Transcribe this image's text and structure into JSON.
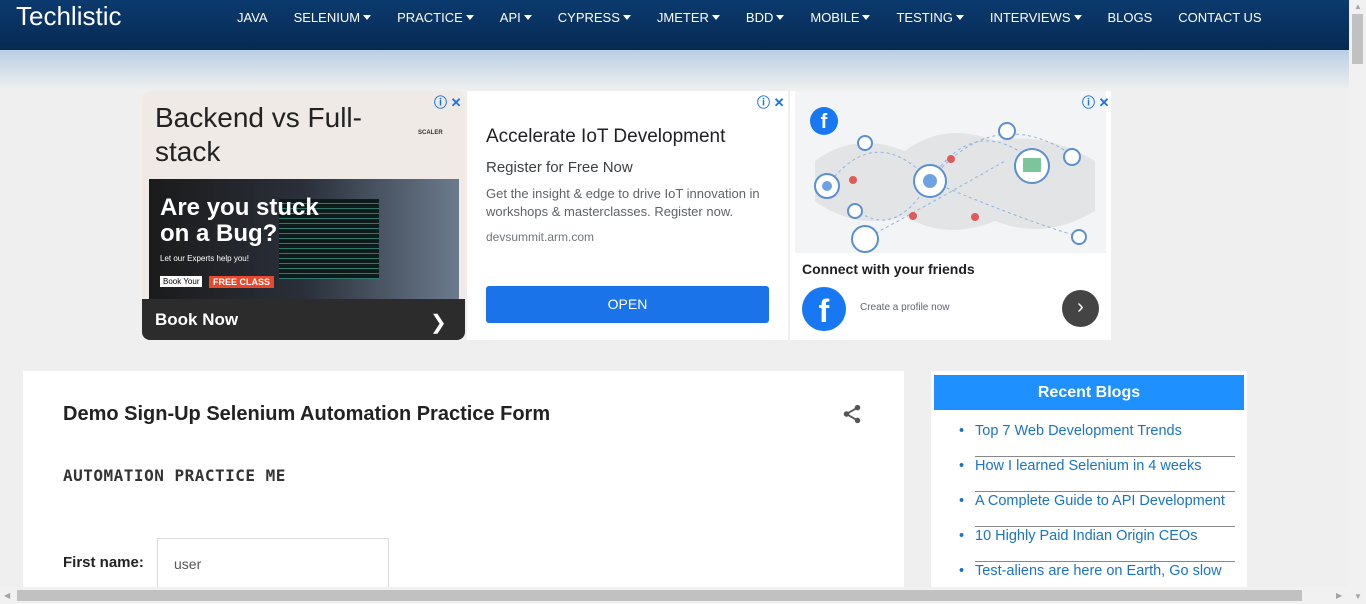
{
  "header": {
    "brand": "Techlistic",
    "nav": [
      {
        "label": "JAVA",
        "dropdown": false
      },
      {
        "label": "SELENIUM",
        "dropdown": true
      },
      {
        "label": "PRACTICE",
        "dropdown": true
      },
      {
        "label": "API",
        "dropdown": true
      },
      {
        "label": "CYPRESS",
        "dropdown": true
      },
      {
        "label": "JMETER",
        "dropdown": true
      },
      {
        "label": "BDD",
        "dropdown": true
      },
      {
        "label": "MOBILE",
        "dropdown": true
      },
      {
        "label": "TESTING",
        "dropdown": true
      },
      {
        "label": "INTERVIEWS",
        "dropdown": true
      },
      {
        "label": "BLOGS",
        "dropdown": false
      },
      {
        "label": "CONTACT US",
        "dropdown": false
      }
    ]
  },
  "ads": {
    "ad1": {
      "headline": "Backend vs Full-stack",
      "logo": "SCALER",
      "stuck": "Are you stuck on a Bug?",
      "help": "Let our Experts help you!",
      "book_your": "Book Your",
      "free_class": "FREE CLASS",
      "cta": "Book Now"
    },
    "ad2": {
      "title": "Accelerate IoT Development",
      "subtitle": "Register for Free Now",
      "body": "Get the insight & edge to drive IoT innovation in workshops & masterclasses. Register now.",
      "domain": "devsummit.arm.com",
      "cta": "OPEN"
    },
    "ad3": {
      "connect": "Connect with your friends",
      "create": "Create a profile now"
    },
    "adchoice_icon": "info-close-icon"
  },
  "main": {
    "title": "Demo Sign-Up Selenium Automation Practice Form",
    "section": "AUTOMATION PRACTICE ME",
    "first_name_label": "First name:",
    "first_name_value": "user"
  },
  "sidebar": {
    "heading": "Recent Blogs",
    "items": [
      "Top 7 Web Development Trends",
      "How I learned Selenium in 4 weeks",
      "A Complete Guide to API Development",
      "10 Highly Paid Indian Origin CEOs",
      "Test-aliens are here on Earth, Go slow"
    ]
  },
  "colors": {
    "nav_bg": "#062a53",
    "accent": "#1e90ff",
    "link": "#1a73c6",
    "cta_blue": "#1a73e8"
  }
}
